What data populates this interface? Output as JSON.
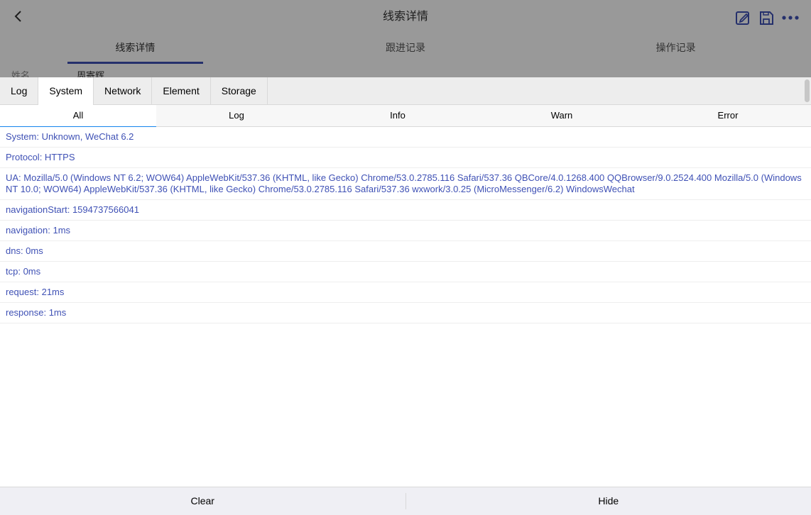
{
  "app": {
    "title": "线索详情",
    "tabs": [
      "线索详情",
      "跟进记录",
      "操作记录"
    ],
    "field_label": "姓名",
    "field_value": "周寄辉",
    "accent": "#3f51b5",
    "icons": [
      "back-icon",
      "edit-icon",
      "save-icon",
      "more-icon"
    ]
  },
  "console": {
    "tabs": [
      "Log",
      "System",
      "Network",
      "Element",
      "Storage"
    ],
    "active_tab": "System",
    "filters": [
      "All",
      "Log",
      "Info",
      "Warn",
      "Error"
    ],
    "active_filter": "All",
    "entries": [
      "System: Unknown, WeChat 6.2",
      "Protocol: HTTPS",
      "UA: Mozilla/5.0 (Windows NT 6.2; WOW64) AppleWebKit/537.36 (KHTML, like Gecko) Chrome/53.0.2785.116 Safari/537.36 QBCore/4.0.1268.400 QQBrowser/9.0.2524.400 Mozilla/5.0 (Windows NT 10.0; WOW64) AppleWebKit/537.36 (KHTML, like Gecko) Chrome/53.0.2785.116 Safari/537.36 wxwork/3.0.25 (MicroMessenger/6.2) WindowsWechat",
      "navigationStart: 1594737566041",
      "navigation: 1ms",
      "dns: 0ms",
      "tcp: 0ms",
      "request: 21ms",
      "response: 1ms"
    ],
    "clear_label": "Clear",
    "hide_label": "Hide",
    "log_color": "#3f51b5"
  }
}
